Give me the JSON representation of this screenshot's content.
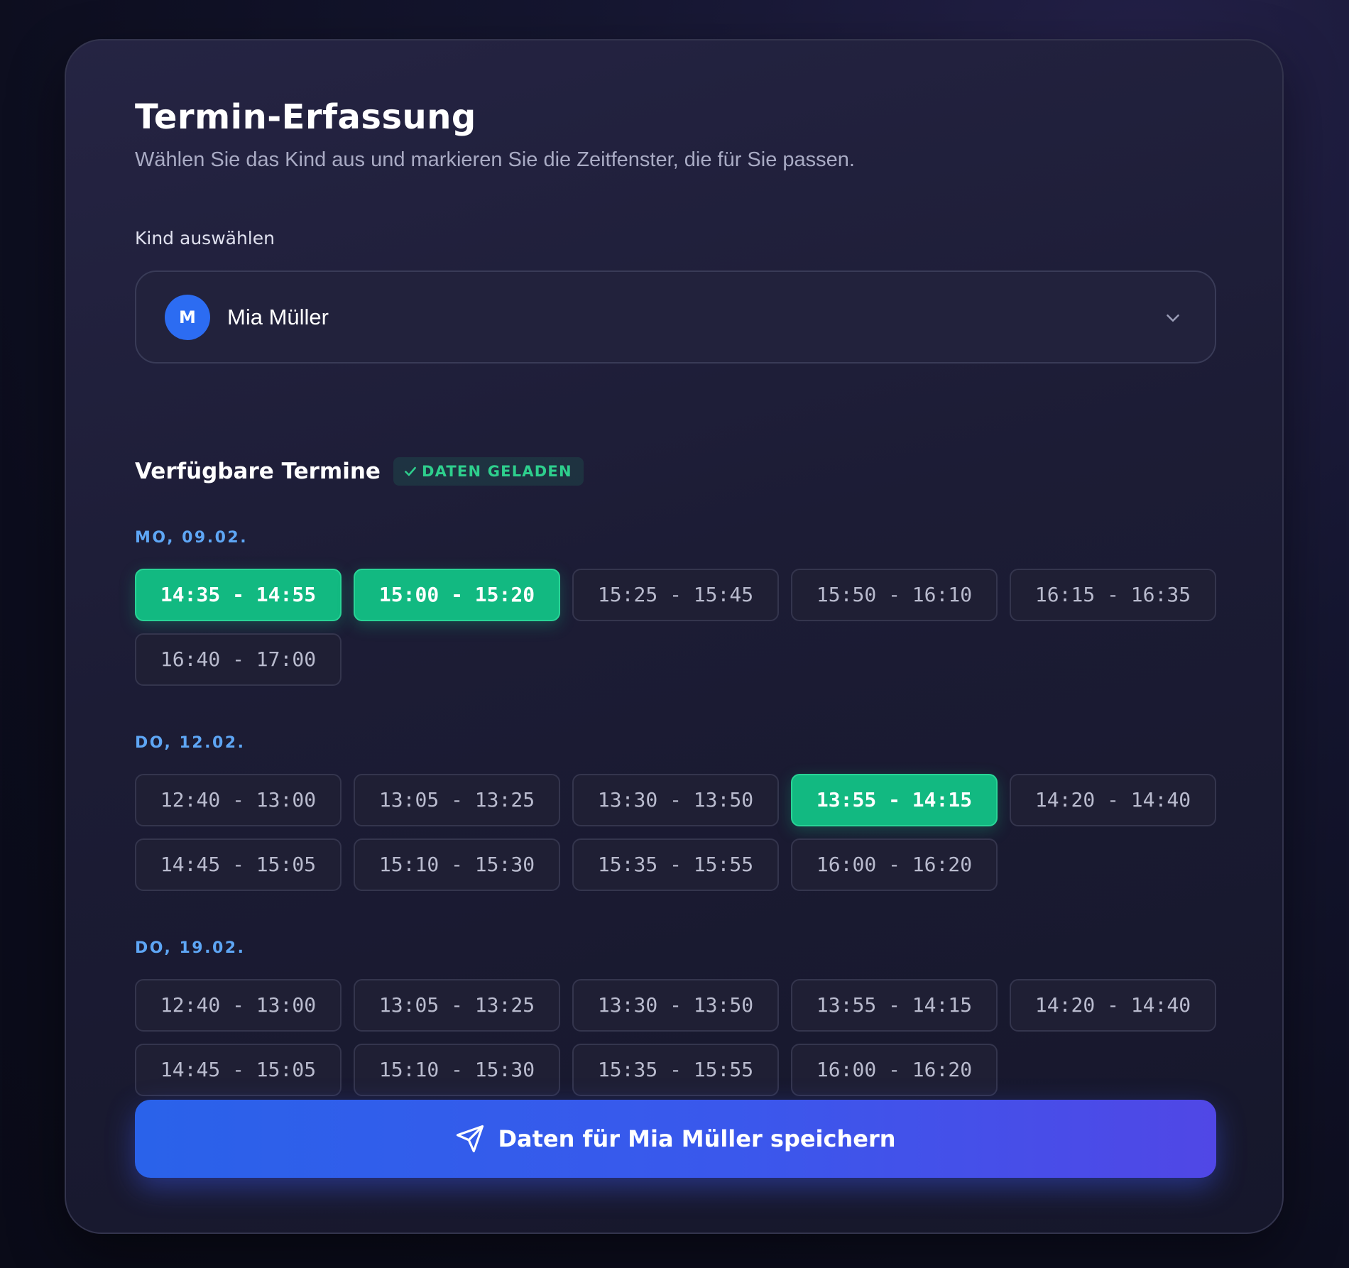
{
  "header": {
    "title": "Termin-Erfassung",
    "subtitle": "Wählen Sie das Kind aus und markieren Sie die Zeitfenster, die für Sie passen."
  },
  "child_select": {
    "label": "Kind auswählen",
    "avatar_initial": "M",
    "selected_value": "Mia Müller",
    "icon": "chevron-down-icon"
  },
  "appointments": {
    "title": "Verfügbare Termine",
    "status_badge": "DATEN GELADEN",
    "status_icon": "check-icon",
    "days": [
      {
        "label": "MO, 09.02.",
        "slots": [
          {
            "time": "14:35 - 14:55",
            "selected": true
          },
          {
            "time": "15:00 - 15:20",
            "selected": true
          },
          {
            "time": "15:25 - 15:45",
            "selected": false
          },
          {
            "time": "15:50 - 16:10",
            "selected": false
          },
          {
            "time": "16:15 - 16:35",
            "selected": false
          },
          {
            "time": "16:40 - 17:00",
            "selected": false
          }
        ]
      },
      {
        "label": "DO, 12.02.",
        "slots": [
          {
            "time": "12:40 - 13:00",
            "selected": false
          },
          {
            "time": "13:05 - 13:25",
            "selected": false
          },
          {
            "time": "13:30 - 13:50",
            "selected": false
          },
          {
            "time": "13:55 - 14:15",
            "selected": true
          },
          {
            "time": "14:20 - 14:40",
            "selected": false
          },
          {
            "time": "14:45 - 15:05",
            "selected": false
          },
          {
            "time": "15:10 - 15:30",
            "selected": false
          },
          {
            "time": "15:35 - 15:55",
            "selected": false
          },
          {
            "time": "16:00 - 16:20",
            "selected": false
          }
        ]
      },
      {
        "label": "DO, 19.02.",
        "slots": [
          {
            "time": "12:40 - 13:00",
            "selected": false
          },
          {
            "time": "13:05 - 13:25",
            "selected": false
          },
          {
            "time": "13:30 - 13:50",
            "selected": false
          },
          {
            "time": "13:55 - 14:15",
            "selected": false
          },
          {
            "time": "14:20 - 14:40",
            "selected": false
          },
          {
            "time": "14:45 - 15:05",
            "selected": false
          },
          {
            "time": "15:10 - 15:30",
            "selected": false
          },
          {
            "time": "15:35 - 15:55",
            "selected": false
          },
          {
            "time": "16:00 - 16:20",
            "selected": false
          }
        ]
      }
    ]
  },
  "save_button": {
    "label": "Daten für Mia Müller speichern",
    "icon": "send-icon"
  },
  "colors": {
    "accent_green": "#12b981",
    "accent_blue": "#2c6cf2",
    "day_label": "#5ea6f5",
    "button_gradient_end": "#5047e6"
  }
}
